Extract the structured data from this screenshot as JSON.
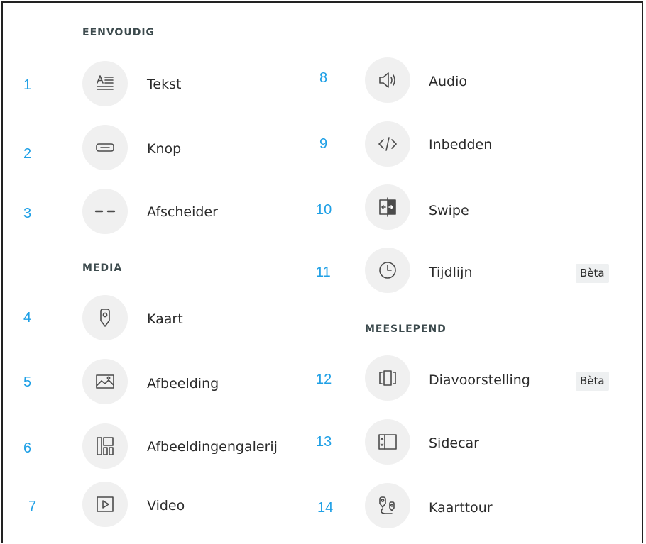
{
  "sections": {
    "simple": "EENVOUDIG",
    "media": "MEDIA",
    "immersive": "MEESLEPEND"
  },
  "items": [
    {
      "number": "1",
      "label": "Tekst",
      "icon": "text-icon"
    },
    {
      "number": "2",
      "label": "Knop",
      "icon": "button-icon"
    },
    {
      "number": "3",
      "label": "Afscheider",
      "icon": "separator-icon"
    },
    {
      "number": "4",
      "label": "Kaart",
      "icon": "map-pin-icon"
    },
    {
      "number": "5",
      "label": "Afbeelding",
      "icon": "image-icon"
    },
    {
      "number": "6",
      "label": "Afbeeldingengalerij",
      "icon": "gallery-icon"
    },
    {
      "number": "7",
      "label": "Video",
      "icon": "video-play-icon"
    },
    {
      "number": "8",
      "label": "Audio",
      "icon": "speaker-icon"
    },
    {
      "number": "9",
      "label": "Inbedden",
      "icon": "embed-code-icon"
    },
    {
      "number": "10",
      "label": "Swipe",
      "icon": "swipe-icon"
    },
    {
      "number": "11",
      "label": "Tijdlijn",
      "icon": "clock-icon",
      "badge": "Bèta"
    },
    {
      "number": "12",
      "label": "Diavoorstelling",
      "icon": "slideshow-icon",
      "badge": "Bèta"
    },
    {
      "number": "13",
      "label": "Sidecar",
      "icon": "sidecar-icon"
    },
    {
      "number": "14",
      "label": "Kaarttour",
      "icon": "map-tour-icon"
    }
  ]
}
